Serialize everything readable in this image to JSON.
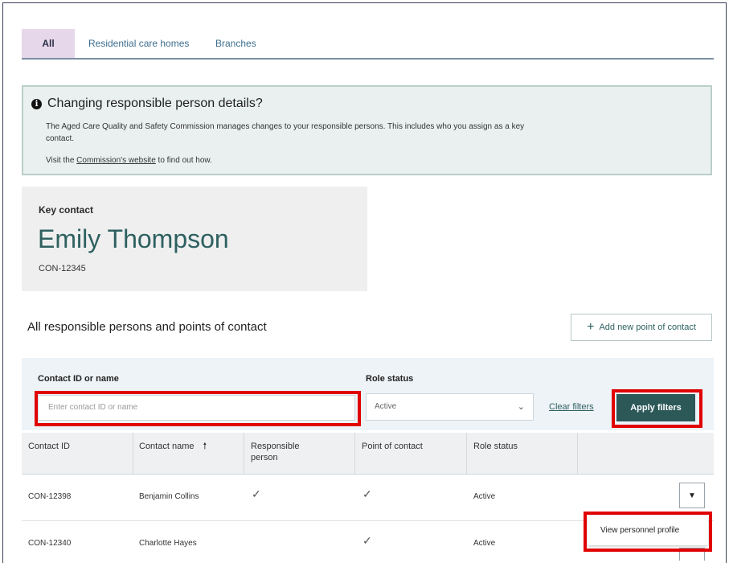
{
  "tabs": [
    {
      "label": "All",
      "active": true
    },
    {
      "label": "Residential care homes",
      "active": false
    },
    {
      "label": "Branches",
      "active": false
    }
  ],
  "banner": {
    "title": "Changing responsible person details?",
    "body": "The Aged Care Quality and Safety Commission manages changes to your responsible persons.  This includes who you assign as a key contact.",
    "visit_prefix": "Visit the ",
    "visit_link": "Commission's website",
    "visit_suffix": " to find out how."
  },
  "key_contact": {
    "label": "Key contact",
    "name": "Emily Thompson",
    "id": "CON-12345"
  },
  "section": {
    "title": "All responsible persons and points of contact",
    "add_button": "Add new point of contact"
  },
  "filters": {
    "contact_label": "Contact ID or name",
    "contact_placeholder": "Enter contact ID or name",
    "role_label": "Role status",
    "role_value": "Active",
    "clear_label": "Clear filters",
    "apply_label": "Apply filters"
  },
  "table": {
    "columns": [
      "Contact ID",
      "Contact name",
      "Responsible person",
      "Point of contact",
      "Role status"
    ],
    "rows": [
      {
        "id": "CON-12398",
        "name": "Benjamin Collins",
        "responsible": "✓",
        "point": "✓",
        "status": "Active"
      },
      {
        "id": "CON-12340",
        "name": "Charlotte Hayes",
        "responsible": "",
        "point": "✓",
        "status": "Active"
      }
    ]
  },
  "row_menu": {
    "item": "View personnel profile"
  },
  "colors": {
    "accent": "#2c5858",
    "highlight": "#e00000",
    "tab_active_bg": "#e6d8ea"
  },
  "icons": {
    "info": "info-icon",
    "add": "plus-icon",
    "sort": "sort-up-icon",
    "select": "chevron-down-icon",
    "row_action": "caret-down-icon"
  }
}
